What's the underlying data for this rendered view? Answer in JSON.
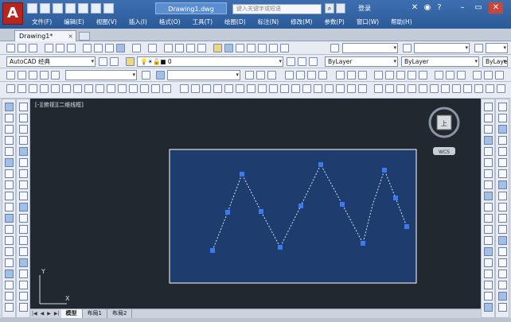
{
  "app": {
    "logo_letter": "A",
    "document_title": "Drawing1.dwg",
    "search_placeholder": "键入关键字或短语",
    "user_label": "登录",
    "help_icon": "?"
  },
  "menu": [
    "文件(F)",
    "编辑(E)",
    "视图(V)",
    "插入(I)",
    "格式(O)",
    "工具(T)",
    "绘图(D)",
    "标注(N)",
    "修改(M)",
    "参数(P)",
    "窗口(W)",
    "帮助(H)"
  ],
  "window_controls": [
    "–",
    "▭",
    "✕"
  ],
  "doc_tab": {
    "label": "Drawing1*",
    "close": "×"
  },
  "toolbar": {
    "workspace": "AutoCAD 经典",
    "layer_value": "0",
    "color_value": "ByLayer",
    "linetype_value": "ByLayer",
    "lineweight_value": "ByLayer"
  },
  "viewport": {
    "label": "[-][俯视][二维线框]",
    "viewcube_face": "上",
    "viewcube_wcs": "WCS",
    "ucs_x": "X",
    "ucs_y": "Y"
  },
  "drawing": {
    "polyline_vertex_count": 11,
    "line_style": "dashed-selected",
    "grip_color": "#3b7bf0",
    "rect_color": "#ffffff",
    "selection_fill": "#1e3c6e"
  },
  "layout_tabs": {
    "nav": [
      "|◀",
      "◀",
      "▶",
      "▶|"
    ],
    "tabs": [
      "模型",
      "布局1",
      "布局2"
    ],
    "active": "模型"
  },
  "colors": {
    "titlebar": "#2c5a98",
    "canvas": "#212830",
    "toolbar": "#e8ecf2"
  }
}
